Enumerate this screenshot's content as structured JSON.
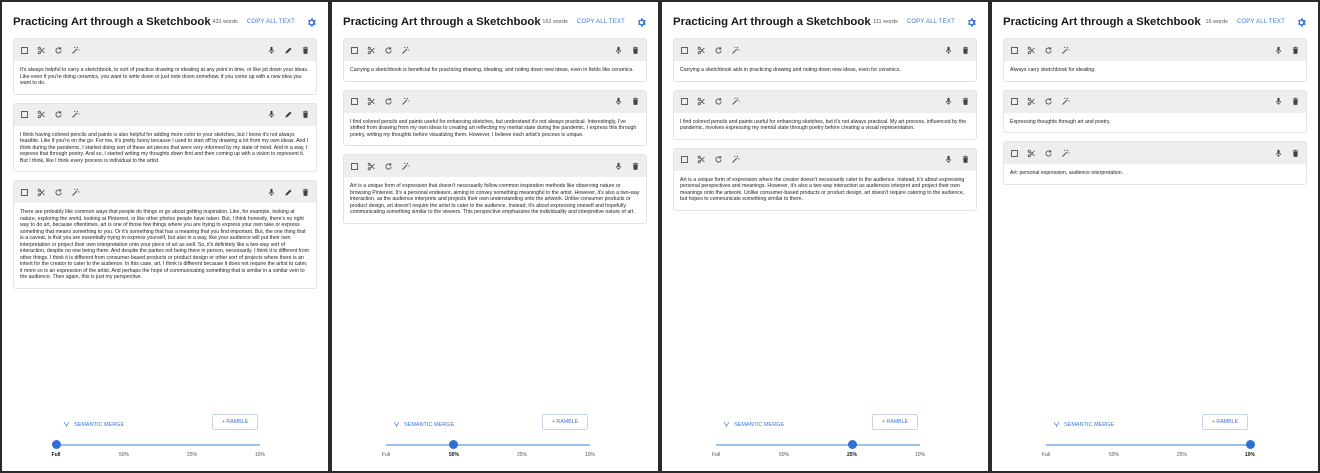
{
  "panels": [
    {
      "title": "Practicing Art through a Sketchbook",
      "word_count": "431 words",
      "copy_label": "COPY ALL TEXT",
      "cards": [
        {
          "text": "It's always helpful to carry a sketchbook, to sort of practice drawing or ideating at any point in time, or like jot down your ideas. Like even if you're doing ceramics, you want to write down or just note down somehow, if you come up with a new idea you want to do."
        },
        {
          "text": "I think having colored pencils and paints is also helpful for adding more color to your sketches, but I know it's not always feasible. Like if you're on the go. For me, it's pretty funny because I used to start off by drawing a lot from my own ideas. And I think during the pandemic, I started doing sort of these art pieces that were very informed by my state of mind. And in a way, I express that through poetry. And so, I started writing my thoughts down first and then coming up with a vision to represent it. But I think, like I think every process is individual to the artist."
        },
        {
          "text": "There are probably like common ways that people do things or go about getting inspiration. Like, for example, looking at nature, exploring the world, looking at Pinterest, or like other photos people have taken. But, I think honestly, there's no right way to do art, because oftentimes, art is one of those few things where you are trying to express your own take or express something that means something to you. Or it's something that has a meaning that you find important. But, the one thing that is a caveat, is that you are essentially trying to express yourself, but also in a way, like your audience will put their own interpretation or project their own interpretation onto your piece of art as well. So, it's definitely like a two-way sort of interaction, despite no one being there. And despite the parties not being there in person, necessarily. I think it is different from other things. I think it is different from consumer-based products or product design or other sort of projects where there is an intent for the creator to cater to the audience. In this case, art, I think is different because it does not require the artist to cater, it more so is an expression of the artist. And perhaps the hope of communicating something that is similar in a similar vein to the audience. Then again, this is just my perspective."
        }
      ],
      "show_edit": true,
      "slider_level": 0
    },
    {
      "title": "Practicing Art through a Sketchbook",
      "word_count": "162 words",
      "copy_label": "COPY ALL TEXT",
      "cards": [
        {
          "text": "Carrying a sketchbook is beneficial for practicing drawing, ideating, and noting down new ideas, even in fields like ceramics."
        },
        {
          "text": "I find colored pencils and paints useful for enhancing sketches, but understand it's not always practical. Interestingly, I've shifted from drawing from my own ideas to creating art reflecting my mental state during the pandemic. I express this through poetry, writing my thoughts before visualizing them. However, I believe each artist's process is unique."
        },
        {
          "text": "Art is a unique form of expression that doesn't necessarily follow common inspiration methods like observing nature or browsing Pinterest. It's a personal endeavor, aiming to convey something meaningful to the artist. However, it's also a two-way interaction, as the audience interprets and projects their own understanding onto the artwork. Unlike consumer products or product design, art doesn't require the artist to cater to the audience. Instead, it's about expressing oneself and hopefully communicating something similar to the viewers. This perspective emphasizes the individuality and interpretive nature of art."
        }
      ],
      "show_edit": false,
      "slider_level": 1
    },
    {
      "title": "Practicing Art through a Sketchbook",
      "word_count": "111 words",
      "copy_label": "COPY ALL TEXT",
      "cards": [
        {
          "text": "Carrying a sketchbook aids in practicing drawing and noting down new ideas, even for ceramics."
        },
        {
          "text": "I find colored pencils and paints useful for enhancing sketches, but it's not always practical. My art process, influenced by the pandemic, involves expressing my mental state through poetry before creating a visual representation."
        },
        {
          "text": "Art is a unique form of expression where the creator doesn't necessarily cater to the audience. Instead, it's about expressing personal perspectives and meanings. However, it's also a two-way interaction as audiences interpret and project their own meanings onto the artwork. Unlike consumer-based products or product design, art doesn't require catering to the audience, but hopes to communicate something similar to them."
        }
      ],
      "show_edit": false,
      "slider_level": 2
    },
    {
      "title": "Practicing Art through a Sketchbook",
      "word_count": "16 words",
      "copy_label": "COPY ALL TEXT",
      "cards": [
        {
          "text": "Always carry sketchbook for ideating."
        },
        {
          "text": "Expressing thoughts through art and poetry."
        },
        {
          "text": "Art: personal expression, audience interpretation."
        }
      ],
      "show_edit": false,
      "slider_level": 3
    }
  ],
  "controls": {
    "merge_label": "SEMANTIC MERGE",
    "ramble_label": "+ RAMBLE",
    "slider_ticks": [
      "Full",
      "50%",
      "25%",
      "10%"
    ]
  },
  "icons": {
    "checkbox": "checkbox-icon",
    "scissors": "scissors-icon",
    "refresh": "refresh-icon",
    "magic": "magic-wand-icon",
    "mic": "microphone-icon",
    "edit": "pencil-icon",
    "delete": "trash-icon",
    "gear": "gear-icon",
    "merge": "merge-icon"
  },
  "colors": {
    "accent": "#3c78d8",
    "slider_track": "#9dc0ee",
    "slider_knob": "#2f6fd6",
    "toolbar_bg": "#eeeeee"
  }
}
